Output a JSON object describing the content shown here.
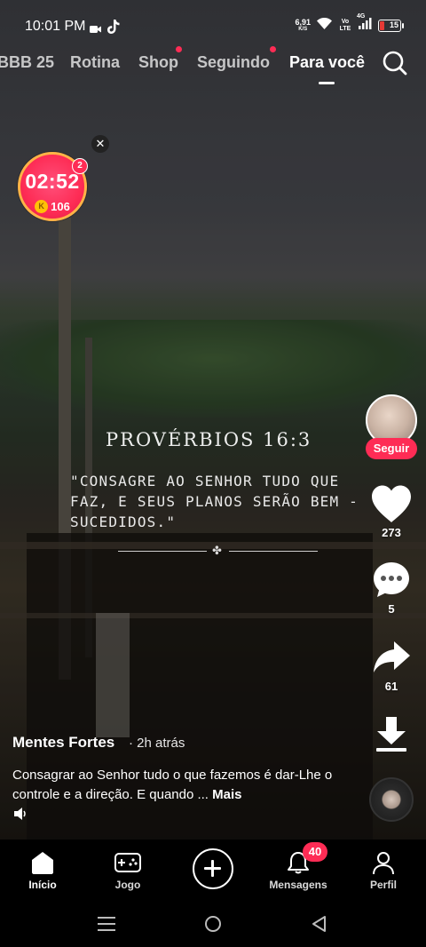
{
  "status_bar": {
    "time": "10:01 PM",
    "net_speed_value": "6,91",
    "net_speed_unit": "K/S",
    "volte": "Vo LTE",
    "network": "4G",
    "battery": "15",
    "icons": [
      "video-icon",
      "tiktok-icon",
      "wifi-icon",
      "signal-icon",
      "battery-icon"
    ]
  },
  "top_tabs": {
    "items": [
      {
        "label": "BBB 25",
        "dot": false
      },
      {
        "label": "Rotina",
        "dot": false
      },
      {
        "label": "Shop",
        "dot": true
      },
      {
        "label": "Seguindo",
        "dot": true
      },
      {
        "label": "Para você",
        "dot": false,
        "active": true
      }
    ]
  },
  "timer_widget": {
    "time": "02:52",
    "coins": "106",
    "coin_symbol": "K",
    "badge": "2",
    "close_symbol": "✕"
  },
  "video_overlay": {
    "title": "PROVÉRBIOS 16:3",
    "body": "\"CONSAGRE AO SENHOR TUDO QUE FAZ, E SEUS PLANOS SERÃO BEM - SUCEDIDOS.\"",
    "ornament": "✤"
  },
  "actions": {
    "follow_label": "Seguir",
    "likes": "273",
    "comments": "5",
    "shares": "61"
  },
  "post": {
    "author": "Mentes Fortes",
    "time": "· 2h atrás",
    "caption": "Consagrar ao Senhor tudo o que fazemos é dar-Lhe o controle e a direção. E quando ...",
    "more_label": "Mais"
  },
  "bottom_nav": {
    "items": [
      {
        "label": "Início",
        "icon": "home-icon",
        "active": true
      },
      {
        "label": "Jogo",
        "icon": "gamepad-icon"
      },
      {
        "label": "",
        "icon": "create-icon"
      },
      {
        "label": "Mensagens",
        "icon": "bell-icon",
        "badge": "40"
      },
      {
        "label": "Perfil",
        "icon": "person-icon"
      }
    ]
  },
  "colors": {
    "accent": "#fe2c55",
    "coin": "#ffc107",
    "timer_ring": "#ffb347"
  }
}
